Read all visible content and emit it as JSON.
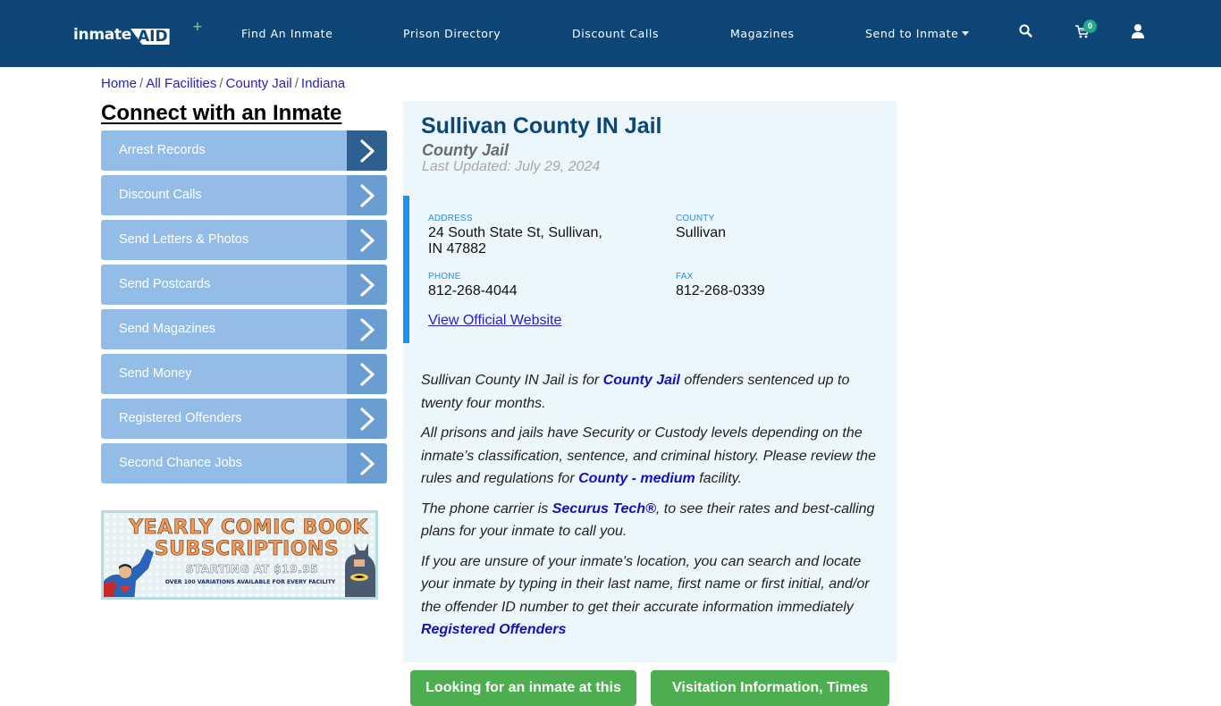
{
  "header": {
    "logo": {
      "part1": "inmate",
      "part2": "AID",
      "plus": "+"
    },
    "nav": [
      {
        "label": "Find An Inmate"
      },
      {
        "label": "Prison Directory"
      },
      {
        "label": "Discount Calls"
      },
      {
        "label": "Magazines"
      },
      {
        "label": "Send to Inmate",
        "has_dropdown": true
      }
    ],
    "icons": [
      "search-icon",
      "cart-icon",
      "user-icon"
    ],
    "cart_count": "0"
  },
  "breadcrumb": [
    {
      "label": "Home"
    },
    {
      "label": "All Facilities"
    },
    {
      "label": "County Jail"
    },
    {
      "label": "Indiana"
    }
  ],
  "breadcrumb_separator": "/",
  "sidebar": {
    "title": "Connect with an Inmate",
    "items": [
      {
        "label": "Arrest Records"
      },
      {
        "label": "Discount Calls"
      },
      {
        "label": "Send Letters & Photos"
      },
      {
        "label": "Send Postcards"
      },
      {
        "label": "Send Magazines"
      },
      {
        "label": "Send Money"
      },
      {
        "label": "Registered Offenders"
      },
      {
        "label": "Second Chance Jobs"
      }
    ],
    "ad": {
      "line1": "YEARLY COMIC BOOK",
      "line2": "SUBSCRIPTIONS",
      "line3": "STARTING AT $19.95",
      "line4": "OVER 100 VARIATIONS AVAILABLE FOR EVERY FACILITY"
    }
  },
  "facility": {
    "name": "Sullivan County IN Jail",
    "type": "County Jail",
    "last_updated": "Last Updated: July 29, 2024",
    "address_label": "ADDRESS",
    "address_line1": "24 South State St, Sullivan,",
    "address_line2": "IN 47882",
    "county_label": "COUNTY",
    "county": "Sullivan",
    "phone_label": "PHONE",
    "phone": "812-268-4044",
    "fax_label": "FAX",
    "fax": "812-268-0339",
    "website_link": "View Official Website"
  },
  "description": {
    "p1_a": "Sullivan County IN Jail is for ",
    "p1_link": "County Jail",
    "p1_b": " offenders sentenced up to twenty four months.",
    "p2_a": "All prisons and jails have Security or Custody levels depending on the inmate’s classification, sentence, and criminal history. Please review the rules and regulations for ",
    "p2_link": "County - medium",
    "p2_b": " facility.",
    "p3_a": "The phone carrier is ",
    "p3_link": "Securus Tech®",
    "p3_b": ", to see their rates and best-calling plans for your inmate to call you.",
    "p4": "If you are unsure of your inmate's location, you can search and locate your inmate by typing in their last name, first name or first initial, and/or the offender ID number to get their accurate information immediately",
    "p4_link": "Registered Offenders"
  },
  "buttons": {
    "locate": "Looking for an inmate at this",
    "visitation": "Visitation Information, Times"
  },
  "colors": {
    "header_bg": "#0d4577",
    "sidebar_item": "#93bde6",
    "sidebar_arrow": "#6a9dd1",
    "sidebar_arrow_active": "#2f5f8f",
    "panel_bg": "#ecf6fd",
    "accent_bar": "#1795ee",
    "green_button": "#4cae4f",
    "link": "#2a1fb8"
  }
}
